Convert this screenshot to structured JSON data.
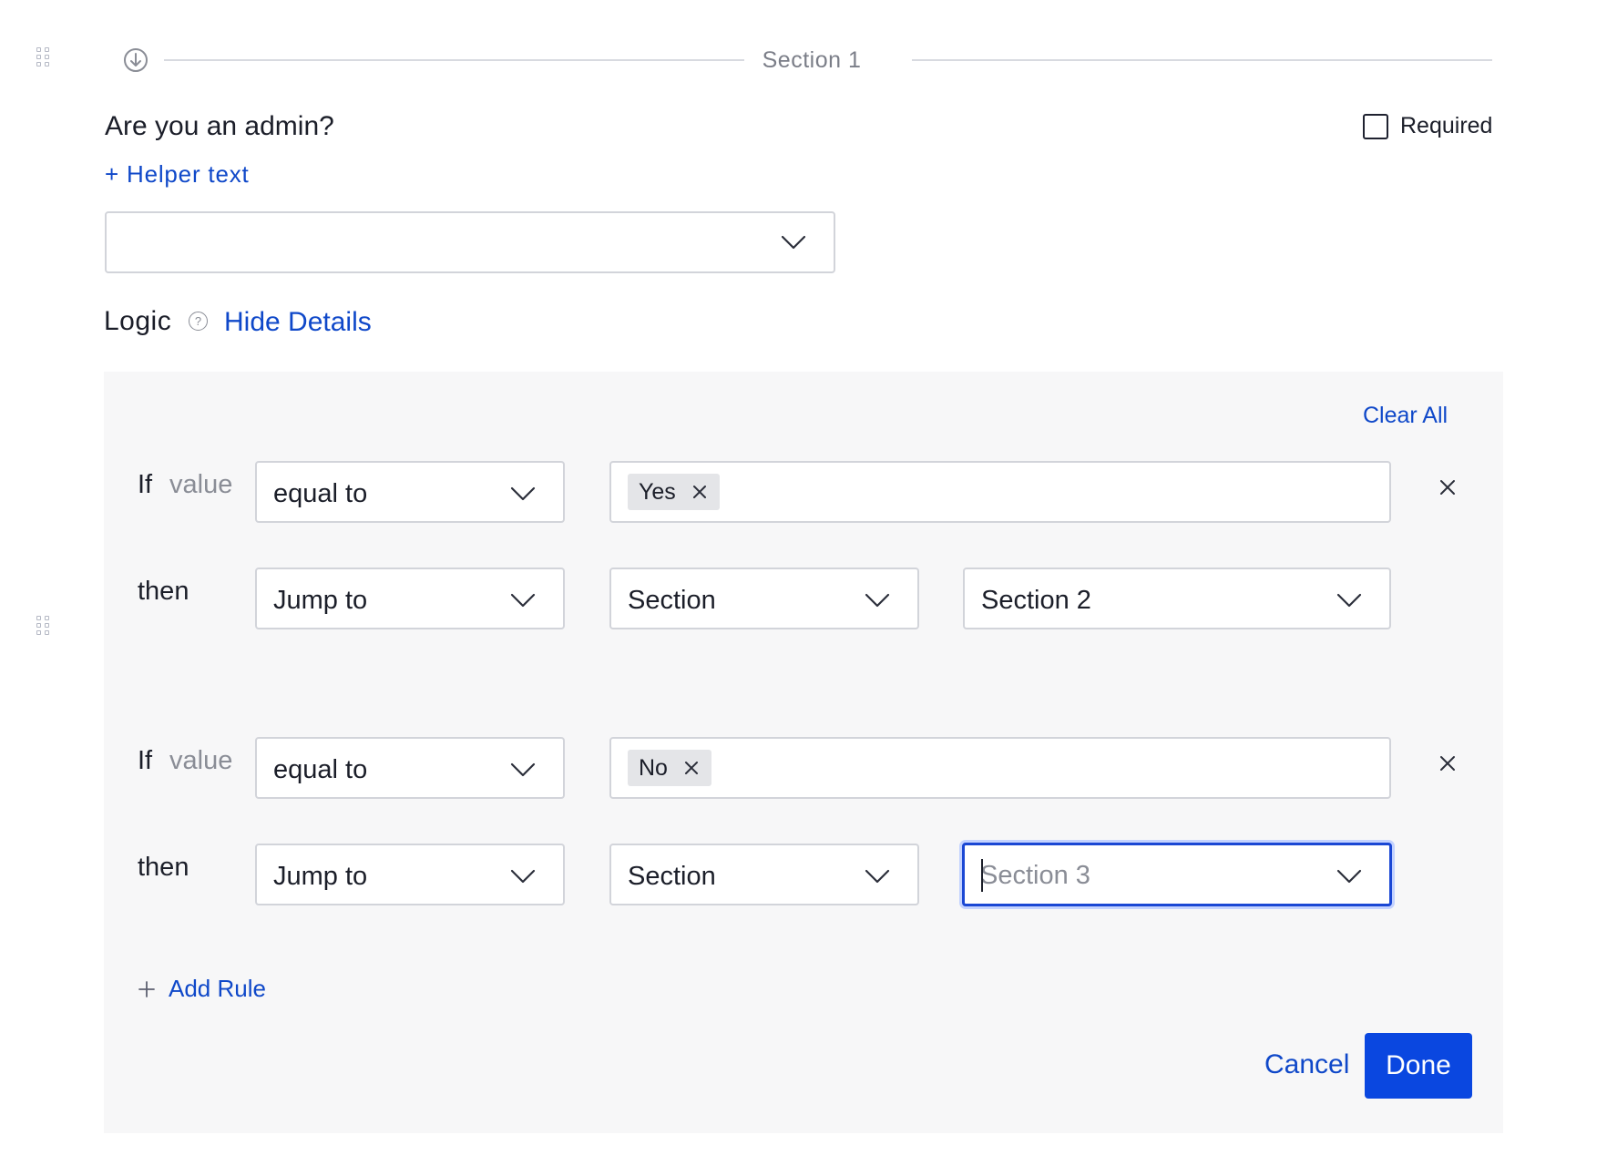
{
  "section": {
    "title": "Section 1",
    "icon": "arrow-down-circle-icon"
  },
  "question": {
    "title": "Are you an admin?",
    "required_label": "Required",
    "required_checked": false,
    "helper_link": "+ Helper text",
    "answer_value": ""
  },
  "logic": {
    "label": "Logic",
    "toggle_link": "Hide Details",
    "clear_all": "Clear All",
    "rules": [
      {
        "if_label": "If",
        "subject": "value",
        "operator": "equal to",
        "tag": "Yes",
        "then_label": "then",
        "action": "Jump to",
        "target_type": "Section",
        "target": "Section 2"
      },
      {
        "if_label": "If",
        "subject": "value",
        "operator": "equal to",
        "tag": "No",
        "then_label": "then",
        "action": "Jump to",
        "target_type": "Section",
        "target": "Section 3"
      }
    ],
    "add_rule": "Add Rule"
  },
  "footer": {
    "cancel": "Cancel",
    "done": "Done"
  },
  "colors": {
    "accent": "#0a47e0",
    "link": "#0f48c9",
    "panel": "#f7f7f8",
    "border": "#d2d4da",
    "focus": "#1a47d4"
  }
}
